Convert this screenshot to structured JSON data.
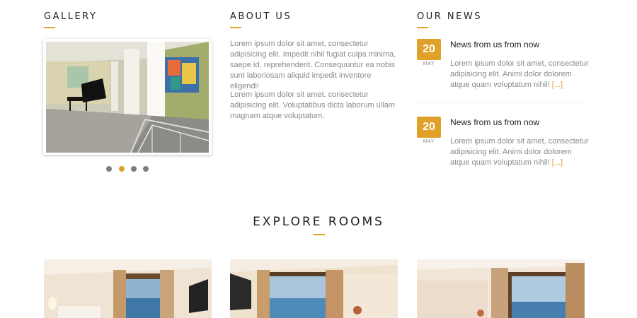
{
  "gallery": {
    "heading": "GALLERY",
    "dots": [
      "slide-1",
      "slide-2",
      "slide-3",
      "slide-4"
    ],
    "active_dot": 2
  },
  "about": {
    "heading": "ABOUT US",
    "paragraph1": "Lorem ipsum dolor sit amet, consectetur adipisicing elit. Impedit nihil fugiat culpa minima, saepe id, reprehenderit. Consequuntur ea nobis sunt laboriosam aliquid impedit inventore eligendi!",
    "paragraph2": "Lorem ipsum dolor sit amet, consectetur adipisicing elit. Voluptatibus dicta laborum ullam magnam atque voluptatum."
  },
  "news": {
    "heading": "OUR NEWS",
    "items": [
      {
        "day": "20",
        "month": "MAY",
        "title": "News from us from now",
        "excerpt": "Lorem ipsum dolor sit amet, consectetur adipisicing elit. Animi dolor dolorem atque quam voluptatum nihil!",
        "readmore": "[...]"
      },
      {
        "day": "20",
        "month": "MAY",
        "title": "News from us from now",
        "excerpt": "Lorem ipsum dolor sit amet, consectetur adipisicing elit. Animi dolor dolorem atque quam voluptatum nihil!",
        "readmore": "[...]"
      }
    ]
  },
  "explore": {
    "heading": "EXPLORE ROOMS"
  },
  "colors": {
    "accent": "#e0a12b",
    "heading": "#222222",
    "body_text": "#8a8a8a"
  }
}
